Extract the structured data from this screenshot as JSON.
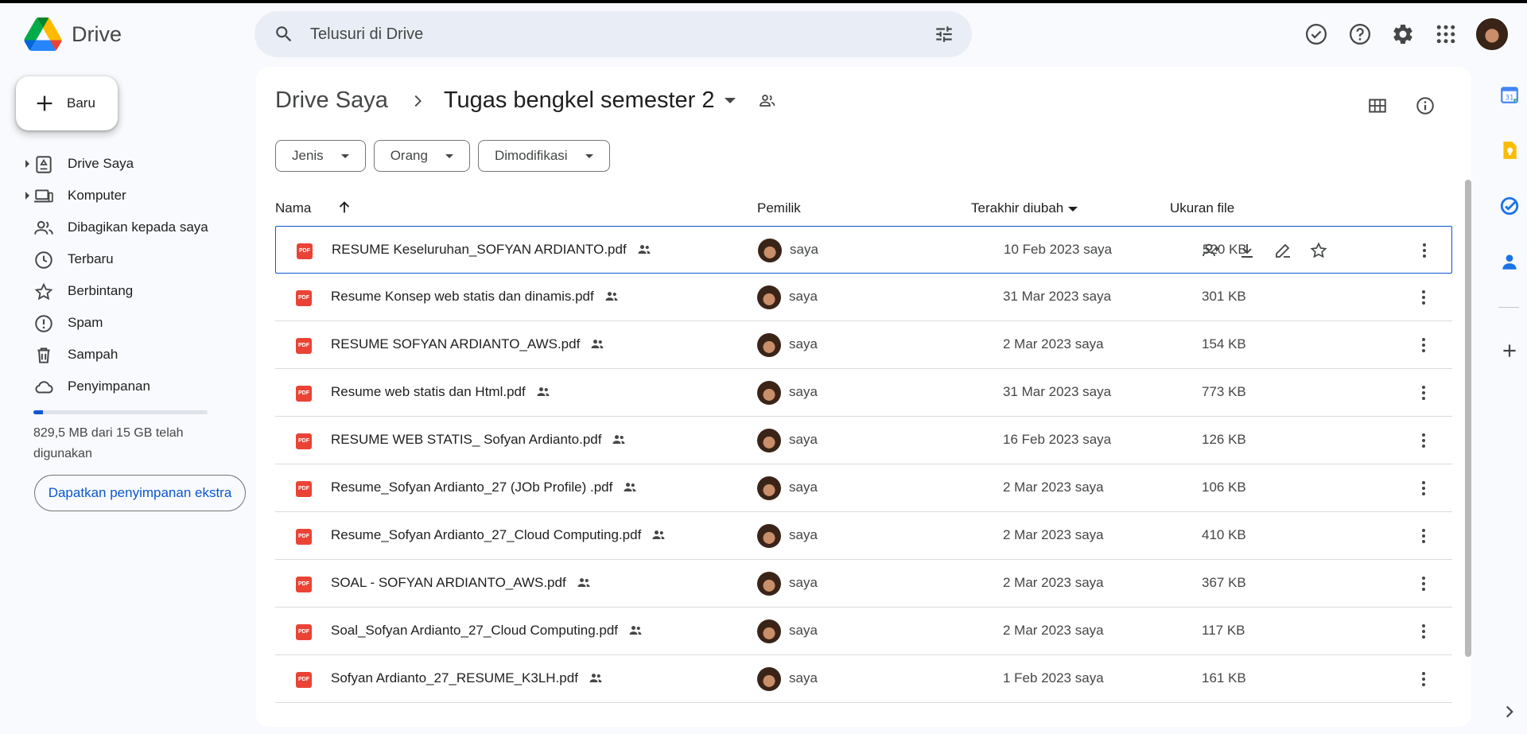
{
  "app": {
    "name": "Drive",
    "search_placeholder": "Telusuri di Drive"
  },
  "sidebar": {
    "new_label": "Baru",
    "items": [
      {
        "label": "Drive Saya",
        "icon": "my-drive-icon",
        "expandable": true
      },
      {
        "label": "Komputer",
        "icon": "computer-icon",
        "expandable": true
      },
      {
        "label": "Dibagikan kepada saya",
        "icon": "shared-with-me-icon",
        "expandable": false
      },
      {
        "label": "Terbaru",
        "icon": "clock-icon",
        "expandable": false
      },
      {
        "label": "Berbintang",
        "icon": "star-icon",
        "expandable": false
      },
      {
        "label": "Spam",
        "icon": "spam-icon",
        "expandable": false
      },
      {
        "label": "Sampah",
        "icon": "trash-icon",
        "expandable": false
      },
      {
        "label": "Penyimpanan",
        "icon": "cloud-icon",
        "expandable": false
      }
    ],
    "storage_text": "829,5 MB dari 15 GB telah digunakan",
    "storage_used_fraction": 0.055,
    "get_storage_label": "Dapatkan penyimpanan ekstra"
  },
  "main": {
    "breadcrumb_root": "Drive Saya",
    "breadcrumb_current": "Tugas bengkel semester 2",
    "filters": [
      "Jenis",
      "Orang",
      "Dimodifikasi"
    ],
    "columns": {
      "name": "Nama",
      "owner": "Pemilik",
      "modified": "Terakhir diubah",
      "size": "Ukuran file"
    },
    "files": [
      {
        "name": "RESUME Keseluruhan_SOFYAN ARDIANTO.pdf",
        "owner": "saya",
        "modified": "10 Feb 2023 saya",
        "size": "520 KB",
        "selected": true
      },
      {
        "name": "Resume Konsep web statis dan dinamis.pdf",
        "owner": "saya",
        "modified": "31 Mar 2023 saya",
        "size": "301 KB"
      },
      {
        "name": "RESUME SOFYAN ARDIANTO_AWS.pdf",
        "owner": "saya",
        "modified": "2 Mar 2023 saya",
        "size": "154 KB"
      },
      {
        "name": "Resume web statis dan Html.pdf",
        "owner": "saya",
        "modified": "31 Mar 2023 saya",
        "size": "773 KB"
      },
      {
        "name": "RESUME WEB STATIS_ Sofyan Ardianto.pdf",
        "owner": "saya",
        "modified": "16 Feb 2023 saya",
        "size": "126 KB"
      },
      {
        "name": "Resume_Sofyan Ardianto_27 (JOb Profile) .pdf",
        "owner": "saya",
        "modified": "2 Mar 2023 saya",
        "size": "106 KB"
      },
      {
        "name": "Resume_Sofyan Ardianto_27_Cloud Computing.pdf",
        "owner": "saya",
        "modified": "2 Mar 2023 saya",
        "size": "410 KB"
      },
      {
        "name": "SOAL - SOFYAN ARDIANTO_AWS.pdf",
        "owner": "saya",
        "modified": "2 Mar 2023 saya",
        "size": "367 KB"
      },
      {
        "name": "Soal_Sofyan Ardianto_27_Cloud Computing.pdf",
        "owner": "saya",
        "modified": "2 Mar 2023 saya",
        "size": "117 KB"
      },
      {
        "name": "Sofyan Ardianto_27_RESUME_K3LH.pdf",
        "owner": "saya",
        "modified": "1 Feb 2023 saya",
        "size": "161 KB"
      }
    ]
  },
  "colors": {
    "accent": "#0b57d0",
    "background": "#f8fafd",
    "search_bg": "#e9eef6",
    "pdf_red": "#ea4335"
  }
}
